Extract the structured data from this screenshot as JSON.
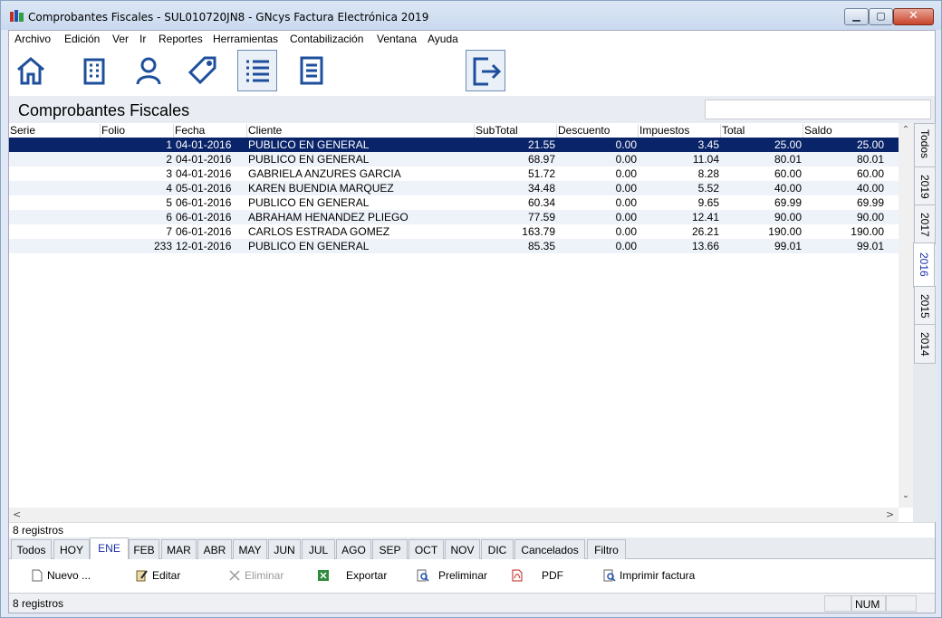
{
  "window": {
    "title": "Comprobantes Fiscales - SUL010720JN8 - GNcys Factura Electrónica 2019",
    "minimize": "▁",
    "maximize": "▢",
    "close": "✕"
  },
  "menu": [
    "Archivo",
    "Edición",
    "Ver",
    "Ir",
    "Reportes",
    "Herramientas",
    "Contabilización",
    "Ventana",
    "Ayuda"
  ],
  "toolbar": {
    "icons": [
      "home-icon",
      "building-icon",
      "user-icon",
      "tag-icon",
      "list-icon",
      "document-icon",
      "exit-icon"
    ],
    "selected": "list-icon"
  },
  "header": {
    "title": "Comprobantes Fiscales",
    "search_value": ""
  },
  "table": {
    "columns": [
      "Serie",
      "Folio",
      "Fecha",
      "Cliente",
      "SubTotal",
      "Descuento",
      "Impuestos",
      "Total",
      "Saldo"
    ],
    "rows": [
      {
        "serie": "",
        "folio": "1",
        "fecha": "04-01-2016",
        "cliente": "PUBLICO EN GENERAL",
        "subtotal": "21.55",
        "descuento": "0.00",
        "impuestos": "3.45",
        "total": "25.00",
        "saldo": "25.00"
      },
      {
        "serie": "",
        "folio": "2",
        "fecha": "04-01-2016",
        "cliente": "PUBLICO EN GENERAL",
        "subtotal": "68.97",
        "descuento": "0.00",
        "impuestos": "11.04",
        "total": "80.01",
        "saldo": "80.01"
      },
      {
        "serie": "",
        "folio": "3",
        "fecha": "04-01-2016",
        "cliente": "GABRIELA ANZURES GARCIA",
        "subtotal": "51.72",
        "descuento": "0.00",
        "impuestos": "8.28",
        "total": "60.00",
        "saldo": "60.00"
      },
      {
        "serie": "",
        "folio": "4",
        "fecha": "05-01-2016",
        "cliente": "KAREN BUENDIA MARQUEZ",
        "subtotal": "34.48",
        "descuento": "0.00",
        "impuestos": "5.52",
        "total": "40.00",
        "saldo": "40.00"
      },
      {
        "serie": "",
        "folio": "5",
        "fecha": "06-01-2016",
        "cliente": "PUBLICO EN GENERAL",
        "subtotal": "60.34",
        "descuento": "0.00",
        "impuestos": "9.65",
        "total": "69.99",
        "saldo": "69.99"
      },
      {
        "serie": "",
        "folio": "6",
        "fecha": "06-01-2016",
        "cliente": "ABRAHAM HENANDEZ PLIEGO",
        "subtotal": "77.59",
        "descuento": "0.00",
        "impuestos": "12.41",
        "total": "90.00",
        "saldo": "90.00"
      },
      {
        "serie": "",
        "folio": "7",
        "fecha": "06-01-2016",
        "cliente": "CARLOS ESTRADA GOMEZ",
        "subtotal": "163.79",
        "descuento": "0.00",
        "impuestos": "26.21",
        "total": "190.00",
        "saldo": "190.00"
      },
      {
        "serie": "",
        "folio": "233",
        "fecha": "12-01-2016",
        "cliente": "PUBLICO EN GENERAL",
        "subtotal": "85.35",
        "descuento": "0.00",
        "impuestos": "13.66",
        "total": "99.01",
        "saldo": "99.01"
      }
    ],
    "selected_row": 0
  },
  "scroll": {
    "left": "<",
    "right": ">",
    "down": "⌄"
  },
  "year_tabs": [
    "Todos",
    "2019",
    "2017",
    "2016",
    "2015",
    "2014"
  ],
  "selected_year": "2016",
  "record_count": "8 registros",
  "month_tabs": [
    "Todos",
    "HOY",
    "ENE",
    "FEB",
    "MAR",
    "ABR",
    "MAY",
    "JUN",
    "JUL",
    "AGO",
    "SEP",
    "OCT",
    "NOV",
    "DIC",
    "Cancelados",
    "Filtro"
  ],
  "selected_month": "ENE",
  "actions": {
    "nuevo": "Nuevo ...",
    "editar": "Editar",
    "eliminar": "Eliminar",
    "exportar": "Exportar",
    "preliminar": "Preliminar",
    "pdf": "PDF",
    "imprimir": "Imprimir factura"
  },
  "status": {
    "text": "8 registros",
    "num": "NUM"
  },
  "colors": {
    "selection": "#0a246a",
    "accent_tab": "#1a2fa8",
    "toolbar_icon": "#1e4f9c"
  }
}
